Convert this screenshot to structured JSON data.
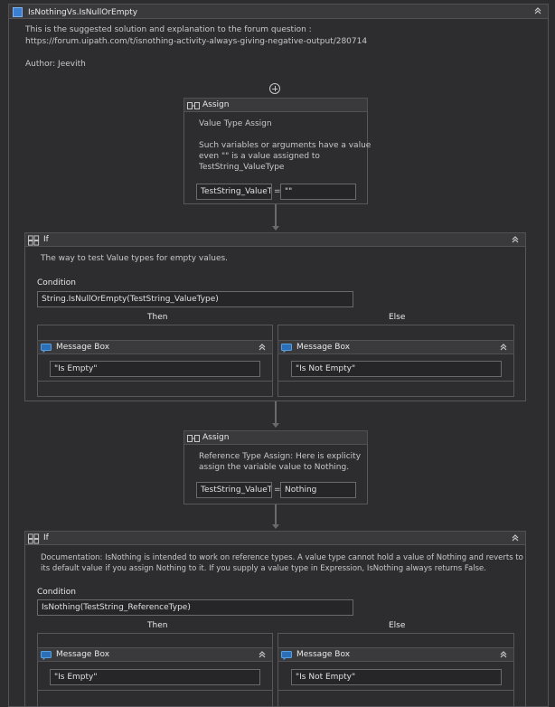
{
  "sequence": {
    "title": "IsNothingVs.IsNullOrEmpty",
    "description_line1": "This is the suggested solution and explanation to the forum question :",
    "description_line2": "https://forum.uipath.com/t/isnothing-activity-always-giving-negative-output/280714",
    "author": "Author: Jeevith"
  },
  "assign1": {
    "header": "Assign",
    "name": "Value Type Assign",
    "note_l1": "Such variables or arguments have a value",
    "note_l2": "even \"\" is a value assigned to",
    "note_l3": "TestString_ValueType",
    "to": "TestString_ValueTyp",
    "eq": "=",
    "value": "\"\""
  },
  "if1": {
    "header": "If",
    "description": "The way to test Value types for empty values.",
    "condition_label": "Condition",
    "condition": "String.IsNullOrEmpty(TestString_ValueType)",
    "then_label": "Then",
    "else_label": "Else",
    "then_box": {
      "header": "Message Box",
      "text": "\"Is Empty\""
    },
    "else_box": {
      "header": "Message Box",
      "text": "\"Is Not Empty\""
    }
  },
  "assign2": {
    "header": "Assign",
    "note_l1": "Reference Type Assign: Here is explicity",
    "note_l2": "assign the variable value to Nothing.",
    "to": "TestString_ValueTyp",
    "eq": "=",
    "value": "Nothing"
  },
  "if2": {
    "header": "If",
    "doc_l1": "Documentation: IsNothing is intended to work on reference types. A value type cannot hold a value of Nothing and reverts to",
    "doc_l2": "its default value if you assign Nothing to it. If you supply a value type in Expression, IsNothing always returns False.",
    "condition_label": "Condition",
    "condition": "IsNothing(TestString_ReferenceType)",
    "then_label": "Then",
    "else_label": "Else",
    "then_box": {
      "header": "Message Box",
      "text": "\"Is Empty\""
    },
    "else_box": {
      "header": "Message Box",
      "text": "\"Is Not Empty\""
    }
  }
}
